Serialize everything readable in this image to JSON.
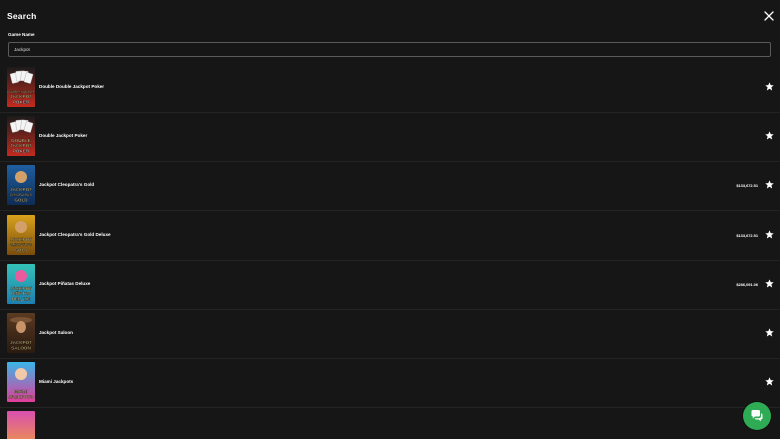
{
  "header": {
    "title": "Search"
  },
  "search": {
    "label": "Game Name",
    "value": "Jackpot"
  },
  "games": [
    {
      "name": "Double Double Jackpot Poker",
      "jackpot": "",
      "thumb_art": "DOUBLE DOUBLE JACKPOT POKER cards",
      "thumb_colors": [
        "#1b1b1b",
        "#c52a1e"
      ],
      "thumb_words": [
        "DOUBLE DOUBLE",
        "JACKPOT",
        "POKER"
      ]
    },
    {
      "name": "Double Jackpot Poker",
      "jackpot": "",
      "thumb_art": "DOUBLE JACKPOT POKER cards",
      "thumb_colors": [
        "#1b1b1b",
        "#c52a1e"
      ],
      "thumb_words": [
        "DOUBLE",
        "JACKPOT",
        "POKER"
      ]
    },
    {
      "name": "Jackpot Cleopatra's Gold",
      "jackpot": "$133,672.51",
      "thumb_art": "cleopatra",
      "thumb_colors": [
        "#1f5fa0",
        "#0e2c55"
      ],
      "thumb_words": [
        "JACKPOT",
        "CLEOPATRA'S",
        "GOLD"
      ]
    },
    {
      "name": "Jackpot Cleopatra's Gold Deluxe",
      "jackpot": "$133,672.51",
      "thumb_art": "cleopatra deluxe",
      "thumb_colors": [
        "#d9a21c",
        "#7a4c0c"
      ],
      "thumb_words": [
        "JACKPOT",
        "CLEOPATRA'S",
        "GOLD"
      ]
    },
    {
      "name": "Jackpot Piñatas Deluxe",
      "jackpot": "$286,091.06",
      "thumb_art": "pinatas",
      "thumb_colors": [
        "#34c3b8",
        "#1d7fb0"
      ],
      "thumb_words": [
        "JACKPOT",
        "PIÑATAS",
        "DELUXE"
      ]
    },
    {
      "name": "Jackpot Saloon",
      "jackpot": "",
      "thumb_art": "saloon",
      "thumb_colors": [
        "#5a3a22",
        "#2a1a10"
      ],
      "thumb_words": [
        "JACKPOT",
        "SALOON"
      ]
    },
    {
      "name": "Miami Jackpots",
      "jackpot": "",
      "thumb_art": "miami",
      "thumb_colors": [
        "#39b6e8",
        "#e23c9a"
      ],
      "thumb_words": [
        "MIAMI",
        "JACKPOTS"
      ]
    },
    {
      "name": "",
      "jackpot": "",
      "thumb_art": "partial",
      "thumb_colors": [
        "#d94fb0",
        "#f0a03c"
      ],
      "thumb_words": []
    }
  ],
  "icons": {
    "close": "close-icon",
    "favorite": "star-icon",
    "chat": "chat-icon"
  },
  "colors": {
    "background": "#161616",
    "chat_button": "#2faa55"
  }
}
